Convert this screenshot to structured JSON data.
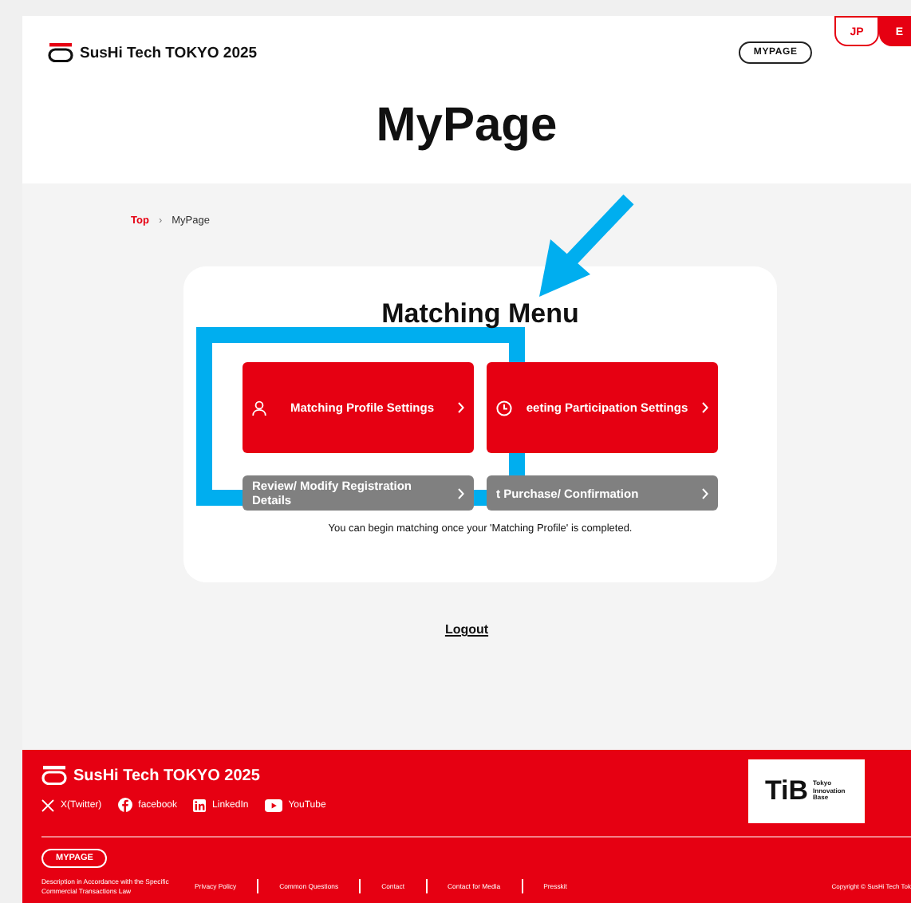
{
  "header": {
    "logo": "SusHi Tech TOKYO 2025",
    "mypage_button": "MYPAGE",
    "languages": [
      {
        "label": "JP",
        "selected": false
      },
      {
        "label": "E",
        "selected": true
      }
    ]
  },
  "page_title": "MyPage",
  "breadcrumb": [
    {
      "label": "Top",
      "kind": "link"
    },
    {
      "label": "›",
      "kind": "separator"
    },
    {
      "label": "MyPage",
      "kind": "current"
    }
  ],
  "matching_menu": {
    "title": "Matching Menu",
    "items": [
      {
        "label": "Matching Profile Settings",
        "kind": "primary"
      },
      {
        "label": "eeting Participation Settings",
        "kind": "primary"
      },
      {
        "label": "Review/ Modify Registration Details",
        "kind": "secondary"
      },
      {
        "label": "t Purchase/ Confirmation",
        "kind": "secondary"
      }
    ],
    "note": "You can begin matching once your 'Matching Profile' is completed."
  },
  "logout": "Logout",
  "footer": {
    "logo": "SusHi Tech TOKYO 2025",
    "social": [
      "X(Twitter)",
      "facebook",
      "LinkedIn",
      "YouTube"
    ],
    "partner_logo": {
      "mark": "TiB",
      "name": "Tokyo Innovation Base"
    },
    "mypage_button": "MYPAGE",
    "links": [
      "Description in Accordance with the Specific Commercial Transactions Law",
      "Privacy Policy",
      "Common Questions",
      "Contact",
      "Contact for Media",
      "Presskit"
    ],
    "copyright": "Copyright © SusHi Tech Tok"
  }
}
